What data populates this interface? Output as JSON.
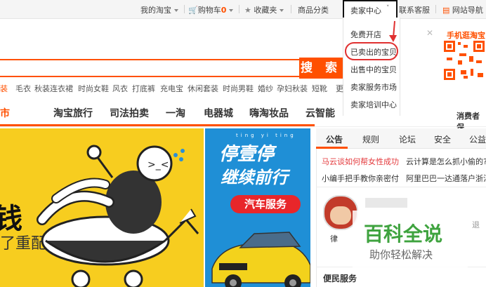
{
  "topbar": {
    "my_taobao": "我的淘宝",
    "cart": "购物车",
    "cart_count": "0",
    "favorites": "收藏夹",
    "categories": "商品分类",
    "seller_center": "卖家中心",
    "support": "联系客服",
    "site_nav": "网站导航"
  },
  "seller_menu": {
    "items": [
      "免费开店",
      "已卖出的宝贝",
      "出售中的宝贝",
      "卖家服务市场",
      "卖家培训中心"
    ]
  },
  "qr": {
    "label": "手机逛淘宝"
  },
  "search": {
    "button_label": "搜 索"
  },
  "hot_words": [
    "装",
    "毛衣",
    "秋装连衣裙",
    "时尚女鞋",
    "风衣",
    "打底裤",
    "充电宝",
    "休闲套装",
    "时尚男鞋",
    "婚纱",
    "孕妇秋装",
    "短靴",
    "更"
  ],
  "nav": {
    "partial": "市",
    "items": [
      "淘宝旅行",
      "司法拍卖",
      "一淘",
      "电器城",
      "嗨淘妆品",
      "云智能"
    ],
    "consumer": "消费者保"
  },
  "banner_left": {
    "big_char": "钱",
    "sub_text": "了重配"
  },
  "banner_right": {
    "headline1": "停壹停",
    "headline2": "继续前行",
    "service": "汽车服务",
    "pinyin1": "ting yi ting"
  },
  "right_panel": {
    "tabs": [
      "公告",
      "规则",
      "论坛",
      "安全",
      "公益"
    ],
    "news": [
      {
        "left": "马云谈如何帮女性成功",
        "right": "云计算是怎么抓小偷的?"
      },
      {
        "left": "小编手把手教你亲密付",
        "right": "阿里巴巴一达通落户浙江"
      }
    ],
    "user_partial": "律",
    "service_title": "便民服务"
  },
  "watermark": {
    "title": "百科全说",
    "subtitle": "助你轻松解决"
  },
  "colors": {
    "accent": "#ff5000",
    "red": "#e03030",
    "news_red": "#e4393c"
  }
}
